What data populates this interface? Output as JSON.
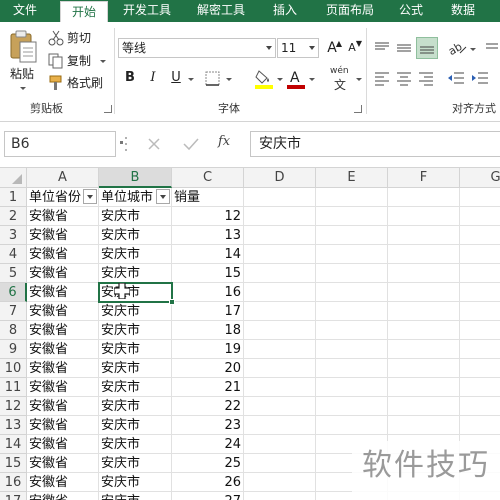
{
  "tabs": [
    {
      "label": "文件",
      "active": false
    },
    {
      "label": "开始",
      "active": true
    },
    {
      "label": "开发工具",
      "active": false
    },
    {
      "label": "解密工具",
      "active": false
    },
    {
      "label": "插入",
      "active": false
    },
    {
      "label": "页面布局",
      "active": false
    },
    {
      "label": "公式",
      "active": false
    },
    {
      "label": "数据",
      "active": false
    }
  ],
  "ribbon": {
    "clipboard": {
      "paste": "粘贴",
      "cut": "剪切",
      "copy": "复制",
      "format_painter": "格式刷",
      "group_label": "剪贴板"
    },
    "font": {
      "font_name": "等线",
      "font_size": "11",
      "bold": "B",
      "italic": "I",
      "underline": "U",
      "grow": "A",
      "shrink": "A",
      "phonetic": "wén",
      "group_label": "字体"
    },
    "alignment": {
      "group_label": "对齐方式"
    }
  },
  "formula_bar": {
    "name_box": "B6",
    "fx": "fx",
    "value": "安庆市"
  },
  "grid": {
    "columns": [
      "A",
      "B",
      "C",
      "D",
      "E",
      "F",
      "G"
    ],
    "selected_column": "B",
    "selected_row": 6,
    "header_row": {
      "A": "单位省份",
      "B": "单位城市",
      "C": "销量"
    },
    "rows": [
      {
        "n": "1"
      },
      {
        "n": "2",
        "a": "安徽省",
        "b": "安庆市",
        "c": "12"
      },
      {
        "n": "3",
        "a": "安徽省",
        "b": "安庆市",
        "c": "13"
      },
      {
        "n": "4",
        "a": "安徽省",
        "b": "安庆市",
        "c": "14"
      },
      {
        "n": "5",
        "a": "安徽省",
        "b": "安庆市",
        "c": "15"
      },
      {
        "n": "6",
        "a": "安徽省",
        "b": "安庆市",
        "c": "16"
      },
      {
        "n": "7",
        "a": "安徽省",
        "b": "安庆市",
        "c": "17"
      },
      {
        "n": "8",
        "a": "安徽省",
        "b": "安庆市",
        "c": "18"
      },
      {
        "n": "9",
        "a": "安徽省",
        "b": "安庆市",
        "c": "19"
      },
      {
        "n": "10",
        "a": "安徽省",
        "b": "安庆市",
        "c": "20"
      },
      {
        "n": "11",
        "a": "安徽省",
        "b": "安庆市",
        "c": "21"
      },
      {
        "n": "12",
        "a": "安徽省",
        "b": "安庆市",
        "c": "22"
      },
      {
        "n": "13",
        "a": "安徽省",
        "b": "安庆市",
        "c": "23"
      },
      {
        "n": "14",
        "a": "安徽省",
        "b": "安庆市",
        "c": "24"
      },
      {
        "n": "15",
        "a": "安徽省",
        "b": "安庆市",
        "c": "25"
      },
      {
        "n": "16",
        "a": "安徽省",
        "b": "安庆市",
        "c": "26"
      },
      {
        "n": "17",
        "a": "安徽省",
        "b": "安庆市",
        "c": "27"
      }
    ]
  },
  "watermark": "软件技巧",
  "colors": {
    "excel_green": "#217346",
    "header_bg": "#f3f3f3",
    "font_color_red": "#c00000",
    "highlight_yellow": "#ffff00"
  }
}
